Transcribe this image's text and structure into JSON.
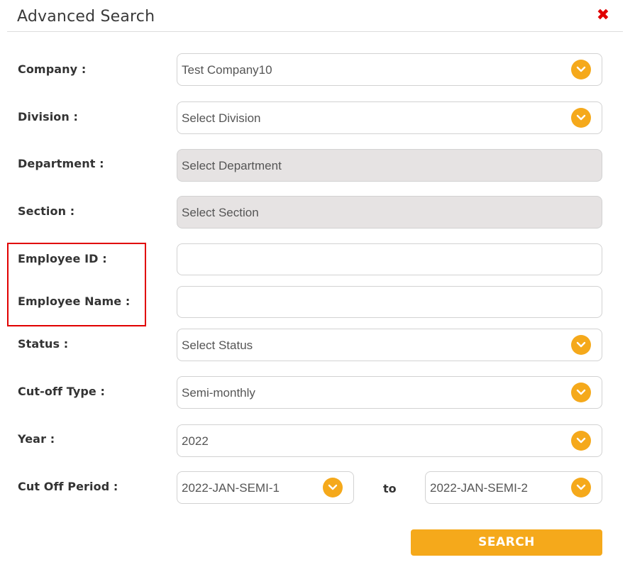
{
  "dialog": {
    "title": "Advanced Search",
    "close_icon": "close-x-icon"
  },
  "fields": {
    "company": {
      "label": "Company :",
      "value": "Test Company10"
    },
    "division": {
      "label": "Division :",
      "value": "Select Division"
    },
    "department": {
      "label": "Department :",
      "value": "Select Department"
    },
    "section": {
      "label": "Section :",
      "value": "Select Section"
    },
    "employee_id": {
      "label": "Employee ID :",
      "value": ""
    },
    "employee_name": {
      "label": "Employee Name :",
      "value": ""
    },
    "status": {
      "label": "Status :",
      "value": "Select Status"
    },
    "cutoff_type": {
      "label": "Cut-off Type :",
      "value": "Semi-monthly"
    },
    "year": {
      "label": "Year :",
      "value": "2022"
    },
    "cutoff_period": {
      "label": "Cut Off Period :",
      "from": "2022-JAN-SEMI-1",
      "separator": "to",
      "to": "2022-JAN-SEMI-2"
    }
  },
  "actions": {
    "search_label": "SEARCH"
  },
  "colors": {
    "accent": "#f5a91b",
    "close": "#e00000",
    "highlight": "#e10000",
    "disabled_bg": "#e6e3e3"
  }
}
